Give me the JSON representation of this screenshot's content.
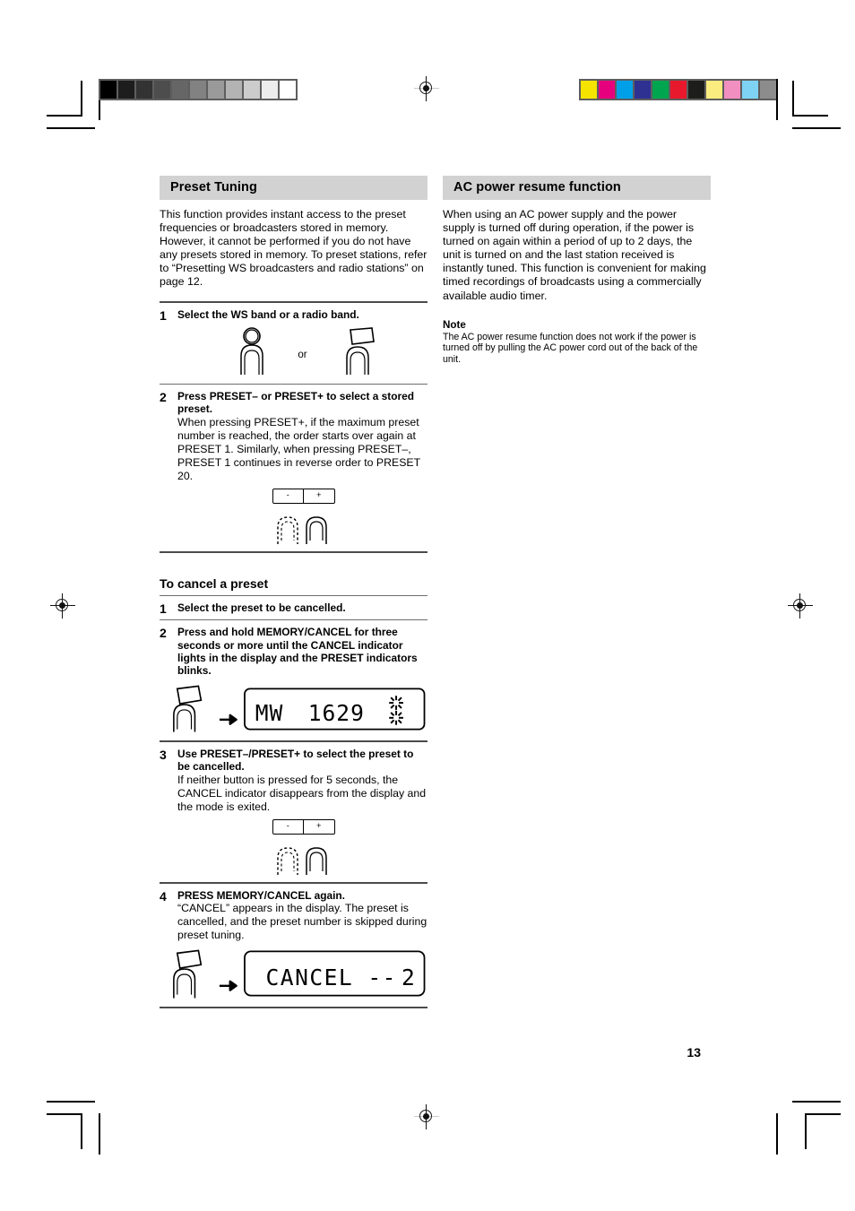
{
  "page": {
    "number": "13"
  },
  "calibration": {
    "gray_strip": [
      "#000000",
      "#1d1d1d",
      "#333333",
      "#4d4d4d",
      "#666666",
      "#828282",
      "#9a9a9a",
      "#b3b3b3",
      "#cccccc",
      "#ececec",
      "#ffffff"
    ],
    "color_strip": [
      "#f5e400",
      "#e6007e",
      "#00a0e9",
      "#2e3192",
      "#00a550",
      "#e8192c",
      "#1d1d1b",
      "#faec7e",
      "#f18fc0",
      "#7ed2f4",
      "#8c8c8c"
    ]
  },
  "left_column": {
    "section_title": "Preset Tuning",
    "intro": "This function provides instant access to the preset frequencies or broadcasters stored in memory. However, it cannot be performed if you do not have any presets stored in memory. To preset stations, refer to “Presetting WS broadcasters and radio stations” on page 12.",
    "steps": [
      {
        "number": "1",
        "lead": "Select the WS band or a radio band.",
        "detail": "",
        "illustration": "two-fingers-band-buttons",
        "or_label": "or"
      },
      {
        "number": "2",
        "lead": "Press PRESET– or PRESET+ to select a stored preset.",
        "detail": "When pressing PRESET+, if the maximum preset number is reached, the order starts over again at PRESET 1. Similarly, when pressing PRESET–, PRESET 1 continues in reverse order to PRESET 20.",
        "illustration": "preset-rocker-two-fingers",
        "button_minus": "-",
        "button_plus": "+"
      }
    ],
    "cancel_section": {
      "title": "To cancel a preset",
      "steps": [
        {
          "number": "1",
          "lead": "Select the preset to be cancelled.",
          "detail": "",
          "illustration": "none"
        },
        {
          "number": "2",
          "lead": "Press and hold MEMORY/CANCEL for three seconds or more until the CANCEL indicator lights in the display and the PRESET indicators blinks.",
          "detail": "",
          "illustration": "finger-arrow-lcd",
          "lcd": {
            "band": "MW",
            "frequency": "1629",
            "blink_indicator": true
          }
        },
        {
          "number": "3",
          "lead": "Use PRESET–/PRESET+ to select the preset to be cancelled.",
          "detail": "If neither button is pressed for 5 seconds, the CANCEL indicator disappears from the display and the mode is exited.",
          "illustration": "preset-rocker-two-fingers",
          "button_minus": "-",
          "button_plus": "+"
        },
        {
          "number": "4",
          "lead": "PRESS MEMORY/CANCEL again.",
          "detail": "“CANCEL” appears in the display. The preset is cancelled, and the preset number is skipped during preset tuning.",
          "illustration": "finger-arrow-lcd",
          "lcd": {
            "text": "CANCEL --",
            "preset_number": "2"
          }
        }
      ]
    }
  },
  "right_column": {
    "section_title": "AC power resume function",
    "body": "When using an AC power supply and the power supply is turned off during operation, if the power is turned on again within a period of up to 2 days, the unit is turned on and the last station received is instantly tuned. This function is convenient for making timed recordings of broadcasts using a commercially available audio timer.",
    "note_title": "Note",
    "note_body": "The AC power resume function does not work if the power is turned off by pulling the AC power cord out of the back of the unit."
  }
}
